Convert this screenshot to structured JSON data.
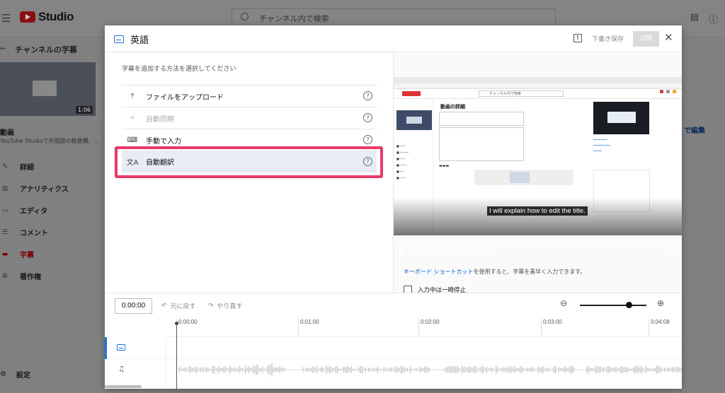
{
  "background": {
    "app_name": "Studio",
    "search_placeholder": "チャンネル内で検索",
    "back_label": "チャンネルの字幕",
    "thumb_duration": "1:06",
    "video_title": "動画",
    "video_subtitle": "YouTube Studioで外国語の概要欄、...",
    "nav_items": [
      {
        "icon": "pencil-icon",
        "label": "詳細"
      },
      {
        "icon": "analytics-icon",
        "label": "アナリティクス"
      },
      {
        "icon": "editor-icon",
        "label": "エディタ"
      },
      {
        "icon": "comment-icon",
        "label": "コメント"
      },
      {
        "icon": "subtitles-icon",
        "label": "字幕"
      },
      {
        "icon": "copyright-icon",
        "label": "著作権"
      }
    ],
    "active_nav": "字幕",
    "settings_label": "設定",
    "right_edge_link": "で編集"
  },
  "dialog": {
    "title": "英語",
    "save_draft": "下書き保存",
    "publish": "公開",
    "prompt": "字幕を追加する方法を選択してください",
    "options": [
      {
        "icon": "upload-icon",
        "label": "ファイルをアップロード",
        "disabled": false
      },
      {
        "icon": "sparkle-icon",
        "label": "自動同期",
        "disabled": true
      },
      {
        "icon": "keyboard-icon",
        "label": "手動で入力",
        "disabled": false
      },
      {
        "icon": "translate-icon",
        "label": "自動翻訳",
        "disabled": false
      }
    ],
    "selected_option": "自動翻訳",
    "highlight_color": "#e8396a",
    "video": {
      "caption": "I will explain how to edit the title.",
      "time": "0:00 / 1:06",
      "inner_title": "動画の詳細",
      "inner_search": "チャンネル内で検索"
    },
    "shortcuts_link": "キーボード ショートカット",
    "shortcuts_text": "を使用すると、字幕を素早く入力できます。",
    "pause_label": "入力中は一時停止"
  },
  "timeline": {
    "current_time": "0:00:00",
    "undo": "元に戻す",
    "redo": "やり直す",
    "ticks": [
      "0:00:00",
      "0:01:00",
      "0:02:00",
      "0:03:00",
      "0:04:08"
    ],
    "zoom_level": 0.7
  },
  "colors": {
    "accent_blue": "#1a73e8",
    "link_blue": "#065fd4",
    "highlight_pink": "#e8396a",
    "youtube_red": "#ff0000"
  }
}
